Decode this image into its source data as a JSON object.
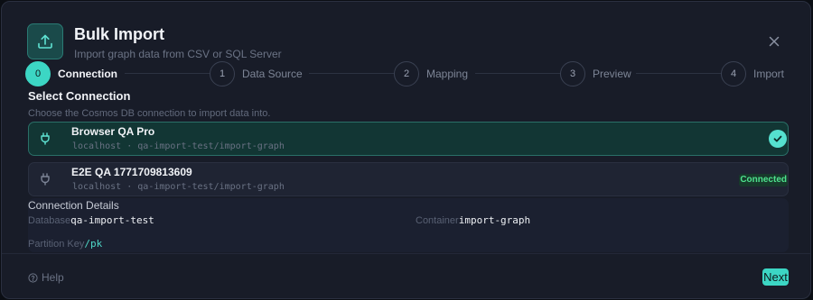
{
  "header": {
    "title": "Bulk Import",
    "subtitle": "Import graph data from CSV or SQL Server",
    "icon": "upload-icon"
  },
  "stepper": {
    "steps": [
      {
        "number": "0",
        "label": "Connection",
        "active": true
      },
      {
        "number": "1",
        "label": "Data Source",
        "active": false
      },
      {
        "number": "2",
        "label": "Mapping",
        "active": false
      },
      {
        "number": "3",
        "label": "Preview",
        "active": false
      },
      {
        "number": "4",
        "label": "Import",
        "active": false
      }
    ]
  },
  "select_connection": {
    "title": "Select Connection",
    "description": "Choose the Cosmos DB connection to import data into.",
    "connections": [
      {
        "name": "Browser QA Pro",
        "host": "localhost",
        "path": "qa-import-test/import-graph",
        "selected": true,
        "status": ""
      },
      {
        "name": "E2E QA 1771709813609",
        "host": "localhost",
        "path": "qa-import-test/import-graph",
        "selected": false,
        "status": "Connected"
      }
    ],
    "separator": "·"
  },
  "details": {
    "title": "Connection Details",
    "database_label": "Database",
    "database_value": "qa-import-test",
    "container_label": "Container",
    "container_value": "import-graph",
    "partition_label": "Partition Key",
    "partition_value": "/pk"
  },
  "footer": {
    "help_label": "Help",
    "next_label": "Next"
  },
  "colors": {
    "accent": "#3cd6c4",
    "connected": "#4ee38e",
    "background": "#181c28"
  }
}
